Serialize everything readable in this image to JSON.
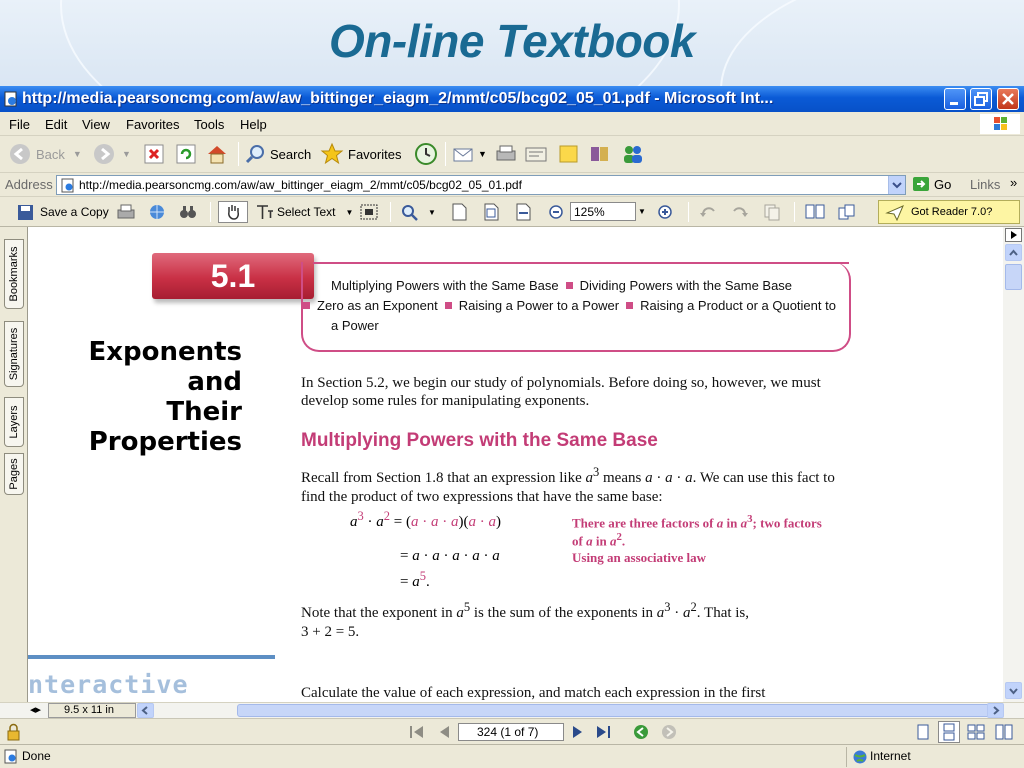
{
  "slide": {
    "title": "On-line Textbook"
  },
  "window": {
    "title": "http://media.pearsoncmg.com/aw/aw_bittinger_eiagm_2/mmt/c05/bcg02_05_01.pdf - Microsoft Int..."
  },
  "menu": [
    "File",
    "Edit",
    "View",
    "Favorites",
    "Tools",
    "Help"
  ],
  "toolbar": {
    "back": "Back",
    "search": "Search",
    "favorites": "Favorites"
  },
  "address": {
    "label": "Address",
    "url": "http://media.pearsoncmg.com/aw/aw_bittinger_eiagm_2/mmt/c05/bcg02_05_01.pdf",
    "go": "Go",
    "links": "Links"
  },
  "reader_toolbar": {
    "save_copy": "Save a Copy",
    "select_text": "Select Text",
    "zoom": "125%",
    "got_reader": "Got Reader 7.0?"
  },
  "nav_tabs": [
    "Bookmarks",
    "Signatures",
    "Layers",
    "Pages"
  ],
  "document": {
    "section_number": "5.1",
    "section_title_line1": "Exponents and",
    "section_title_line2": "Their Properties",
    "topics": [
      "Multiplying Powers with the Same Base",
      "Dividing Powers with the Same Base",
      "Zero as an Exponent",
      "Raising a Power to a Power",
      "Raising a Product or a Quotient to a Power"
    ],
    "intro": "In Section 5.2, we begin our study of polynomials. Before doing so, however, we must develop some rules for manipulating exponents.",
    "subhead": "Multiplying Powers with the Same Base",
    "recall_1": "Recall from Section 1.8 that an expression like ",
    "recall_2": " means ",
    "recall_3": ". We can use this fact to find the product of two expressions that have the same base:",
    "note1_a": "There are three factors of ",
    "note1_b": " in ",
    "note1_c": "; two factors of ",
    "note1_d": " in ",
    "note2": "Using an associative law",
    "sum_1": "Note that the exponent in ",
    "sum_2": " is the sum of the exponents in ",
    "sum_3": ". That is,",
    "sum_4": "3 + 2 = 5.",
    "interactive": "nteractive",
    "calc": "Calculate the value of each expression, and match each expression in the first"
  },
  "page_size": "9.5 x 11 in",
  "page_nav": "324  (1 of 7)",
  "status": {
    "text": "Done",
    "zone": "Internet"
  }
}
